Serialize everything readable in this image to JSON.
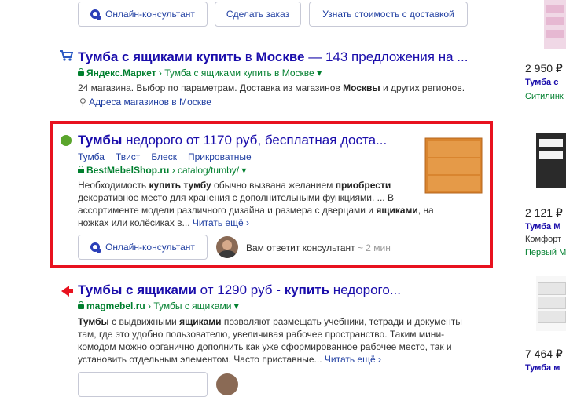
{
  "top_buttons": [
    "Онлайн-консультант",
    "Сделать заказ",
    "Узнать стоимость с доставкой"
  ],
  "result1": {
    "title_b1": "Тумба с ящиками купить",
    "title_mid": " в ",
    "title_b2": "Москве",
    "title_rest": " — 143 предложения на ...",
    "site": "Яндекс.Маркет",
    "path": "› Тумба с ящиками купить в Москве",
    "snippet_a": "24 магазина. Выбор по параметрам. Доставка из магазинов ",
    "snippet_b": "Москвы",
    "snippet_c": " и других регионов.",
    "address": "Адреса магазинов в Москве"
  },
  "result2": {
    "title_b": "Тумбы",
    "title_rest": " недорого от 1170 руб, бесплатная доста...",
    "sitelinks": [
      "Тумба",
      "Твист",
      "Блеск",
      "Прикроватные"
    ],
    "site": "BestMebelShop.ru",
    "path": "› catalog/tumby/",
    "snippet_parts": [
      "Необходимость ",
      "купить тумбу",
      " обычно вызвана желанием ",
      "приобрести",
      " декоративное место для хранения с дополнительными функциями. ... В ассортименте модели различного дизайна и размера с дверцами и ",
      "ящиками",
      ", на ножках или колёсиках в... "
    ],
    "more": "Читать ещё ›",
    "button": "Онлайн-консультант",
    "consultant": "Вам ответит консультант",
    "time": "~ 2 мин"
  },
  "result3": {
    "title_b1": "Тумбы с ящиками",
    "title_mid": " от 1290 руб - ",
    "title_b2": "купить",
    "title_rest": " недорого...",
    "site": "magmebel.ru",
    "path": "› Тумбы с ящиками",
    "snippet_parts": [
      "Тумбы",
      " с выдвижными ",
      "ящиками",
      " позволяют размещать учебники, тетради и документы там, где это удобно пользователю, увеличивая рабочее пространство. Таким мини-комодом можно органично дополнить как уже сформированное рабочее место, так и установить отдельным элементом. Часто приставные... "
    ],
    "more": "Читать ещё ›"
  },
  "right_column": [
    {
      "price": "2 950 ₽",
      "name": "Тумба с",
      "shop": "Ситилинк"
    },
    {
      "price": "2 121 ₽",
      "name": "Тумба М",
      "line2": "Комфорт",
      "shop": "Первый М"
    },
    {
      "price": "7 464 ₽",
      "name": "Тумба м"
    }
  ]
}
